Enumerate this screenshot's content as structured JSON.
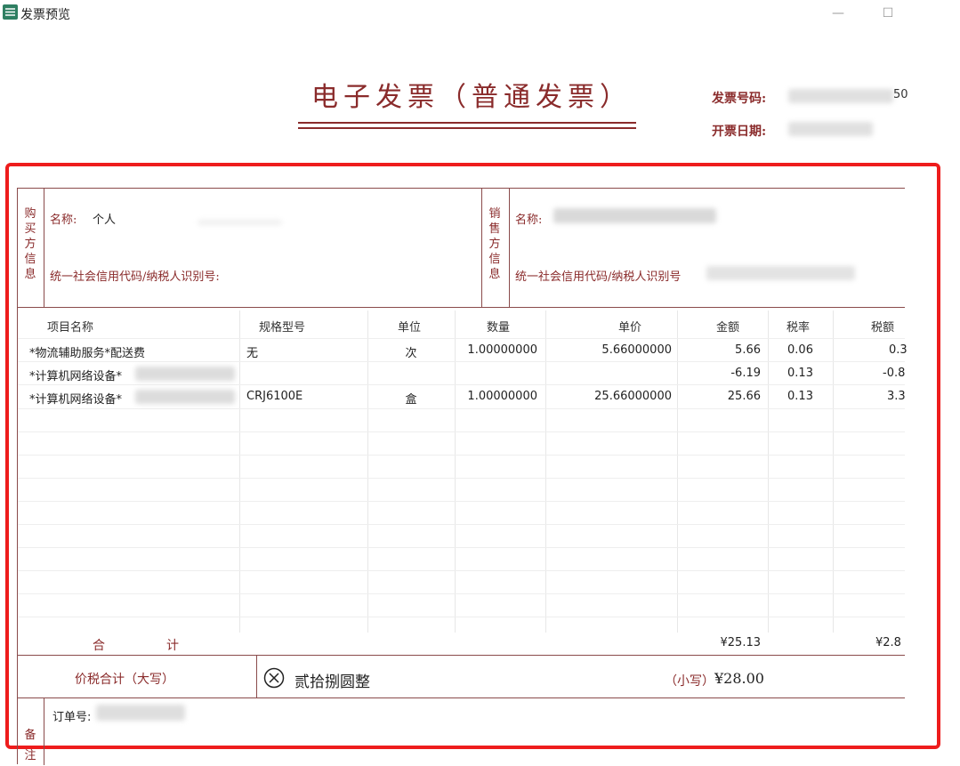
{
  "window": {
    "title": "发票预览",
    "minimize": "—",
    "maximize": "☐"
  },
  "invoice": {
    "title": "电子发票（普通发票）",
    "number_label": "发票号码:",
    "number_tail": "50",
    "date_label": "开票日期:"
  },
  "buyer": {
    "section_label": [
      "购",
      "买",
      "方",
      "信",
      "息"
    ],
    "name_label": "名称:",
    "name_value": "个人",
    "tax_id_label": "统一社会信用代码/纳税人识别号:"
  },
  "seller": {
    "section_label": [
      "销",
      "售",
      "方",
      "信",
      "息"
    ],
    "name_label": "名称:",
    "tax_id_label": "统一社会信用代码/纳税人识别号"
  },
  "items_table": {
    "headers": [
      "项目名称",
      "规格型号",
      "单位",
      "数量",
      "单价",
      "金额",
      "税率",
      "税额"
    ],
    "rows": [
      {
        "name": "*物流辅助服务*配送费",
        "spec": "无",
        "unit": "次",
        "qty": "1.00000000",
        "price": "5.66000000",
        "amount": "5.66",
        "rate": "0.06",
        "tax": "0.3"
      },
      {
        "name": "*计算机网络设备*",
        "spec": "",
        "unit": "",
        "qty": "",
        "price": "",
        "amount": "-6.19",
        "rate": "0.13",
        "tax": "-0.8"
      },
      {
        "name": "*计算机网络设备*",
        "spec": "CRJ6100E",
        "unit": "盒",
        "qty": "1.00000000",
        "price": "25.66000000",
        "amount": "25.66",
        "rate": "0.13",
        "tax": "3.3"
      }
    ]
  },
  "totals": {
    "label_he": "合",
    "label_ji": "计",
    "amount": "¥25.13",
    "tax": "¥2.8"
  },
  "price_tax_total": {
    "label": "价税合计（大写）",
    "icon": "circle-x-icon",
    "uppercase": "贰拾捌圆整",
    "lowercase_label": "（小写）",
    "lowercase_value": "¥28.00"
  },
  "remarks": {
    "section_label": [
      "备",
      "注"
    ],
    "order_label": "订单号:"
  },
  "colors": {
    "border": "#8a4b4b",
    "label": "#8a2b2b",
    "highlight": "#ee1c1c"
  }
}
